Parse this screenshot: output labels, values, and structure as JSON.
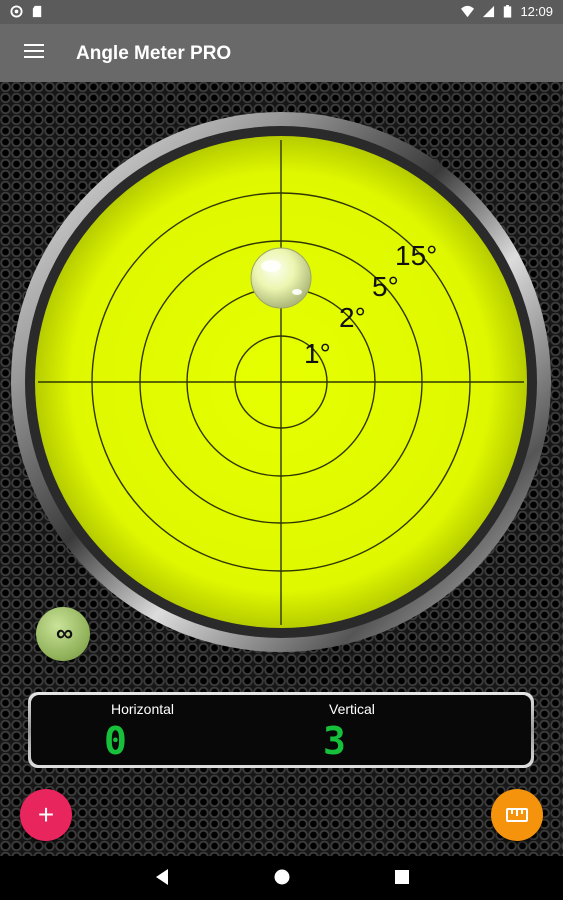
{
  "status_bar": {
    "time": "12:09",
    "icons_left": [
      "settings-dot-icon",
      "sd-card-icon"
    ],
    "icons_right": [
      "wifi-icon",
      "signal-icon",
      "battery-icon"
    ]
  },
  "app_bar": {
    "title": "Angle Meter PRO",
    "menu_icon": "hamburger-menu-icon"
  },
  "level": {
    "ring_labels": [
      "1°",
      "2°",
      "5°",
      "15°"
    ],
    "face_color": "#e5ff00",
    "bubble_offset_degrees": {
      "horizontal": 0,
      "vertical": 3
    }
  },
  "lock_button": {
    "label": "∞"
  },
  "readout": {
    "horizontal_label": "Horizontal",
    "horizontal_value": "0",
    "vertical_label": "Vertical",
    "vertical_value": "3",
    "value_color": "#17c03a"
  },
  "fab_add": {
    "icon": "plus-icon",
    "label": "+",
    "color": "#e8255d"
  },
  "fab_ruler": {
    "icon": "ruler-icon",
    "color": "#f5930c"
  },
  "nav": {
    "icons": [
      "back-icon",
      "home-icon",
      "recents-icon"
    ]
  }
}
